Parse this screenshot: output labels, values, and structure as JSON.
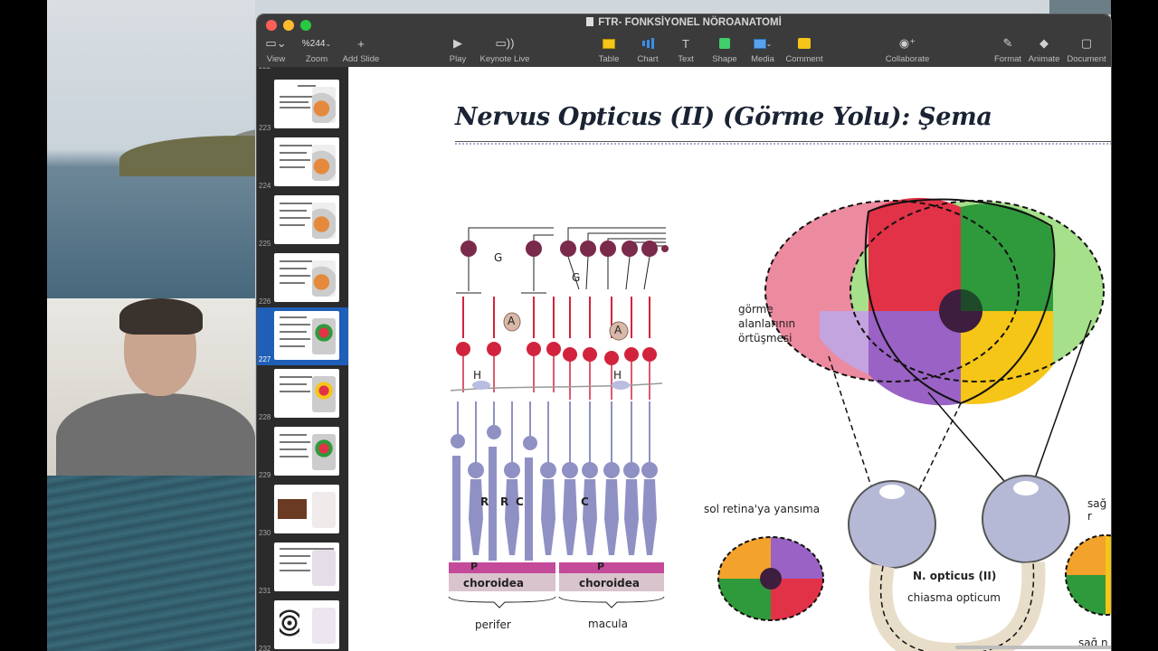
{
  "window": {
    "title": "FTR- FONKSİYONEL NÖROANATOMİ"
  },
  "toolbar": {
    "view": "View",
    "zoom_value": "%244",
    "zoom": "Zoom",
    "add_slide": "Add Slide",
    "play": "Play",
    "keynote_live": "Keynote Live",
    "table": "Table",
    "chart": "Chart",
    "text": "Text",
    "shape": "Shape",
    "media": "Media",
    "comment": "Comment",
    "collaborate": "Collaborate",
    "format": "Format",
    "animate": "Animate",
    "document": "Document"
  },
  "navigator": {
    "slides": [
      {
        "num": "222"
      },
      {
        "num": "223"
      },
      {
        "num": "224"
      },
      {
        "num": "225"
      },
      {
        "num": "226"
      },
      {
        "num": "227"
      },
      {
        "num": "228"
      },
      {
        "num": "229"
      },
      {
        "num": "230"
      },
      {
        "num": "231"
      },
      {
        "num": "232"
      }
    ],
    "selected": "227"
  },
  "slide": {
    "title": "Nervus Opticus (II) (Görme Yolu): Şema",
    "retina_labels": {
      "g1": "G",
      "g2": "G",
      "a1": "A",
      "a2": "A",
      "h1": "H",
      "h2": "H",
      "r1": "R",
      "r2": "R",
      "c1": "C",
      "c2": "C",
      "p1": "P",
      "p2": "P",
      "choroidea1": "choroidea",
      "choroidea2": "choroidea",
      "perifer": "perifer",
      "macula": "macula"
    },
    "visual_labels": {
      "overlap": "görme\nalanlarının\nörtüşmesi",
      "left_retina": "sol retina'ya yansıma",
      "n_opticus": "N. opticus (II)",
      "chiasma": "chiasma opticum",
      "right_partial": "sağ r",
      "right_bottom": "sağ n"
    }
  },
  "colors": {
    "red": "#e23247",
    "green": "#2f9a3c",
    "yellow": "#f5c518",
    "purple": "#9a62c4",
    "pink": "#ec8aa0",
    "lilac": "#c3a4df",
    "orange": "#f3a32b",
    "rod": "#8f91c4",
    "bipolar": "#d2233e",
    "choroid": "#d9c3cc",
    "selection": "#1f5fb8"
  }
}
